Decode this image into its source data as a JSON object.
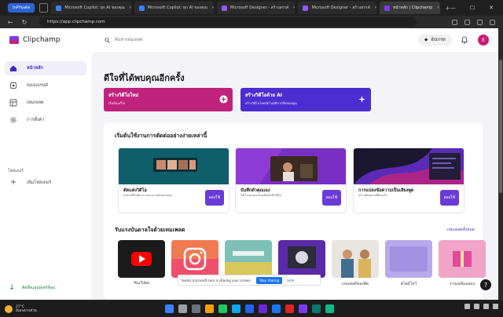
{
  "browser": {
    "private_label": "InPrivate",
    "tabs": [
      {
        "label": "Microsoft Copilot: ทุก AI ของคุณ",
        "color": "#3b82f6"
      },
      {
        "label": "Microsoft Copilot: ทุก AI ของคุณ",
        "color": "#3b82f6"
      },
      {
        "label": "Microsoft Designer - สร้างสรรค์",
        "color": "#8b5cf6"
      },
      {
        "label": "Microsoft Designer - สร้างสรรค์",
        "color": "#8b5cf6"
      },
      {
        "label": "หน้าหลัก | Clipchamp",
        "color": "#7c3aed"
      }
    ],
    "new_tab": "+",
    "url": "https://app.clipchamp.com"
  },
  "app": {
    "brand": "Clipchamp",
    "search_placeholder": "ค้นหาเทมเพลต",
    "premium_label": "อัปเกรด",
    "avatar_initial": "E"
  },
  "sidebar": {
    "items": [
      {
        "label": "หน้าหลัก",
        "icon": "home-icon"
      },
      {
        "label": "ของแบรนด์",
        "icon": "brand-kit-icon"
      },
      {
        "label": "เทมเพลต",
        "icon": "templates-icon"
      },
      {
        "label": "การตั้งค่า",
        "icon": "settings-icon"
      }
    ],
    "section_title": "โฟลเดอร์",
    "add_folder": "เพิ่มโฟลเดอร์",
    "download_app": "ติดตั้งแอปเดสก์ท็อป"
  },
  "main": {
    "welcome": "ดีใจที่ได้พบคุณอีกครั้ง",
    "cta": [
      {
        "title": "สร้างวิดีโอใหม่",
        "subtitle": "เริ่มต้นแก้ไข",
        "color": "#c0237c"
      },
      {
        "title": "สร้างวิดีโอด้วย AI",
        "subtitle": "สร้างวิดีโอโดยอัตโนมัติจากสื่อของคุณ",
        "color": "#4a2ed1"
      }
    ],
    "panel_title": "เริ่มต้นใช้งานการตัดต่ออย่างง่ายเหล่านี้",
    "cards": [
      {
        "title": "ตัดแต่งวิดีโอ",
        "subtitle": "ลบส่วนที่ไม่ต้องการออกจากคลิปของคุณ",
        "button": "ลองใช้"
      },
      {
        "title": "บันทึกตัวคุณเอง",
        "subtitle": "ใช้เว็บแคมของคุณเพื่อบันทึกวิดีโอ",
        "button": "ลองใช้"
      },
      {
        "title": "การแปลงข้อความเป็นเสียงพูด",
        "subtitle": "สร้างเสียงพากย์ที่สมจริง",
        "button": "ลองใช้"
      }
    ],
    "templates_title": "รับแรงบันดาลใจด้วยเทมเพลต",
    "templates_all": "เทมเพลตทั้งหมด",
    "templates": [
      {
        "label": "YouTube",
        "icon": "youtube-icon"
      },
      {
        "label": "",
        "icon": "instagram-icon"
      },
      {
        "label": "",
        "icon": ""
      },
      {
        "label": "",
        "icon": ""
      },
      {
        "label": "เกมเพลย์ของดีด",
        "icon": ""
      },
      {
        "label": "สไลด์โชว์",
        "icon": ""
      },
      {
        "label": "งานเฉลิมฉลอง",
        "icon": ""
      }
    ]
  },
  "share_bar": {
    "text": "teams.microsoft.com is sharing your screen.",
    "stop": "Stop sharing",
    "hide": "Hide"
  },
  "help_label": "?",
  "taskbar": {
    "temperature": "27°C",
    "weather": "มีเมฆบางส่วน"
  }
}
